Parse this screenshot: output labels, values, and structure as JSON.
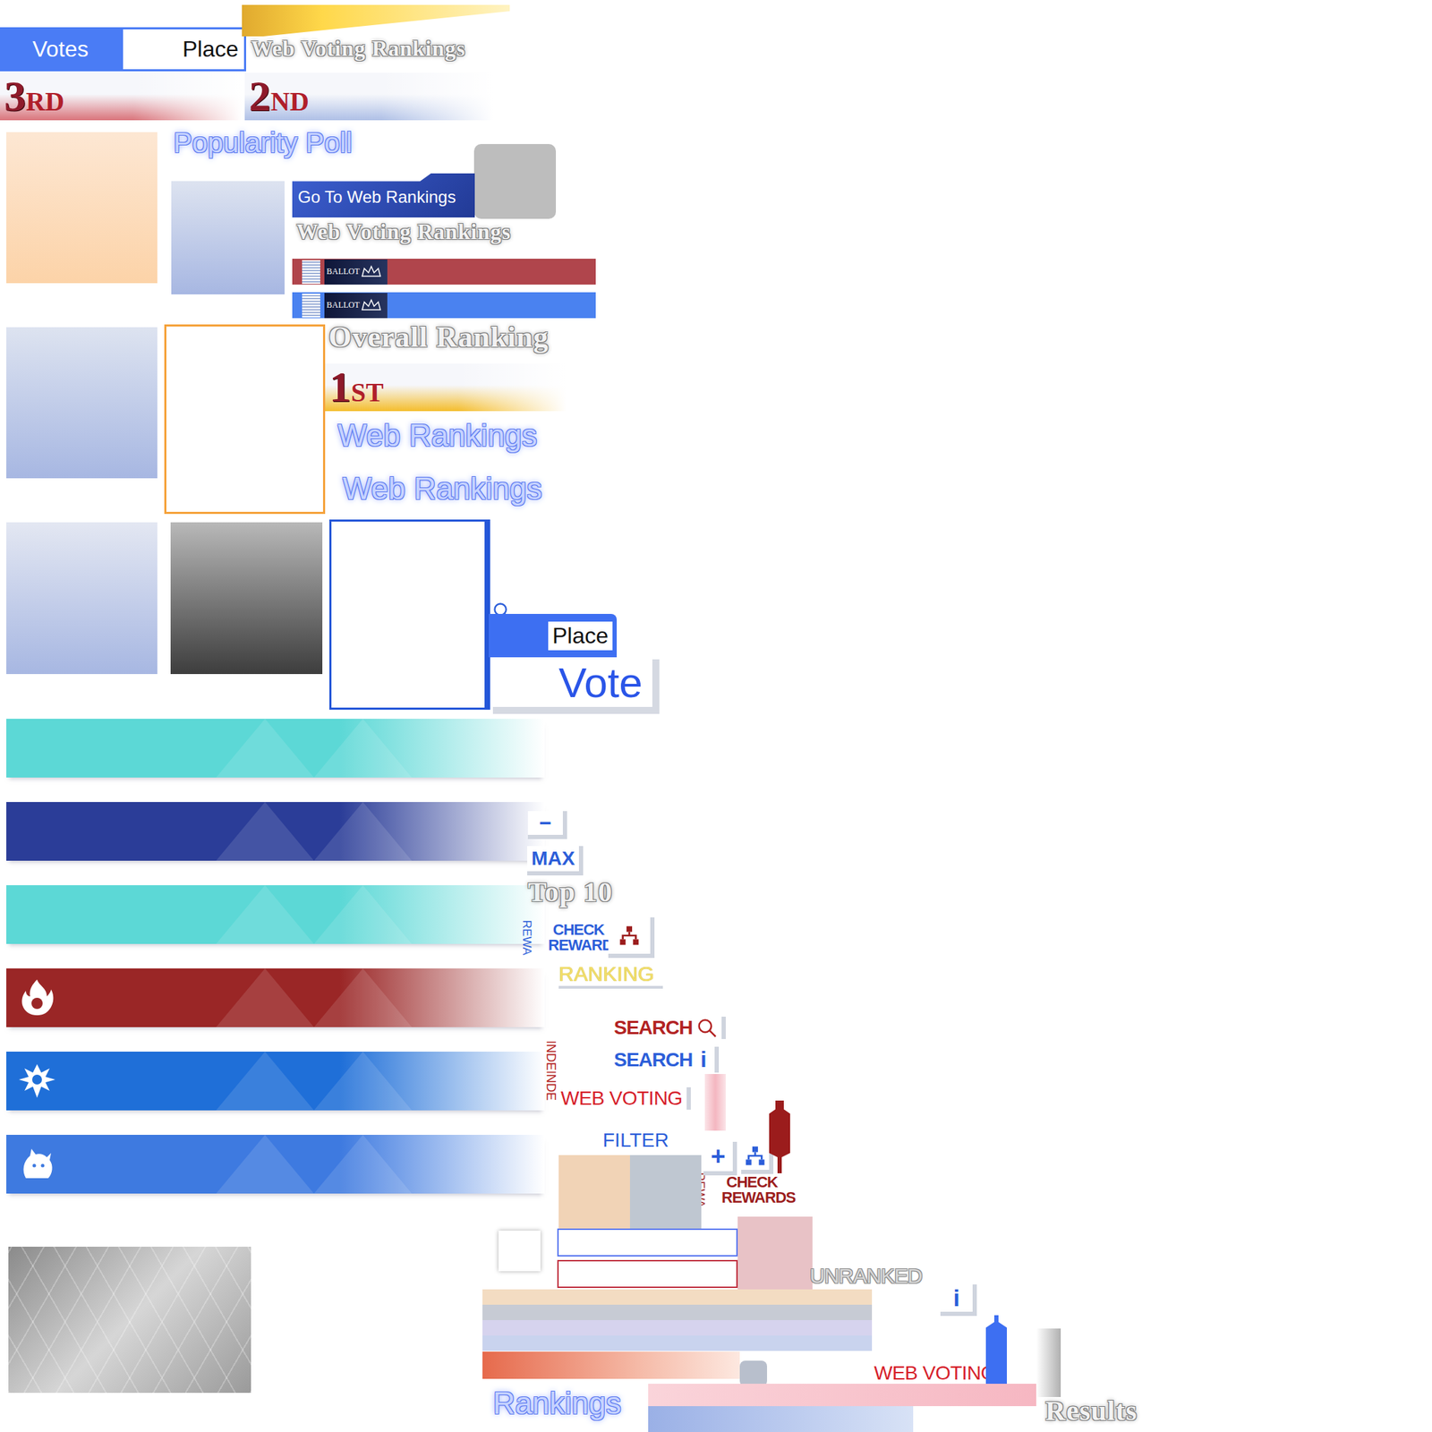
{
  "vote_tab": {
    "votes": "Votes",
    "place": "Place",
    "votes_selected": true
  },
  "ranks": [
    {
      "number": "3",
      "suffix": "RD",
      "color": "#d9737a"
    },
    {
      "number": "2",
      "suffix": "ND",
      "color": "#aebfe6"
    },
    {
      "number": "1",
      "suffix": "ST",
      "color": "#f4bd2c"
    }
  ],
  "serif_titles": [
    "Web Voting Rankings",
    "Web Voting Rankings",
    "Overall Ranking",
    "Top 10",
    "Results"
  ],
  "glow_titles": [
    "Popularity Poll",
    "Web Rankings",
    "Web Rankings",
    "Rankings"
  ],
  "go_button": "Go To Web Rankings",
  "ballots": [
    {
      "label": "BALLOT",
      "color": "#b0454c"
    },
    {
      "label": "BALLOT",
      "color": "#4a82f0"
    }
  ],
  "place_tab": "Place",
  "vote_button": "Vote",
  "minus_button": "−",
  "max_button": "MAX",
  "strips": [
    {
      "kind": "plain",
      "color": "#5cd8d6"
    },
    {
      "kind": "plain",
      "color": "#2b3d98"
    },
    {
      "kind": "plain",
      "color": "#5cd8d6"
    },
    {
      "kind": "fire",
      "color": "#9a2626"
    },
    {
      "kind": "spider",
      "color": "#1f6fd8"
    },
    {
      "kind": "bird",
      "color": "#3e7ae0"
    }
  ],
  "check_rewards": [
    {
      "tab": "REWA",
      "label": "CHECK REWARDS",
      "color": "#2c5ed9",
      "kind": "with_icon"
    },
    {
      "tab": "REWA",
      "label": "CHECK REWARDS",
      "color": "#9b1c1c",
      "kind": "plain"
    }
  ],
  "ranking_label": "RANKING",
  "index_tab": "INDEINDE",
  "search_buttons": [
    {
      "label": "SEARCH",
      "color": "#b22222",
      "kind": "magnifier",
      "glyph": ""
    },
    {
      "label": "SEARCH",
      "color": "#2c5ed9",
      "kind": "info",
      "glyph": "i"
    }
  ],
  "web_voting_labels": [
    "WEB VOTING",
    "WEB VOTING"
  ],
  "filter_label": "FILTER",
  "plus_button": "+",
  "unranked_label": "UNRANKED",
  "info_button": "i"
}
